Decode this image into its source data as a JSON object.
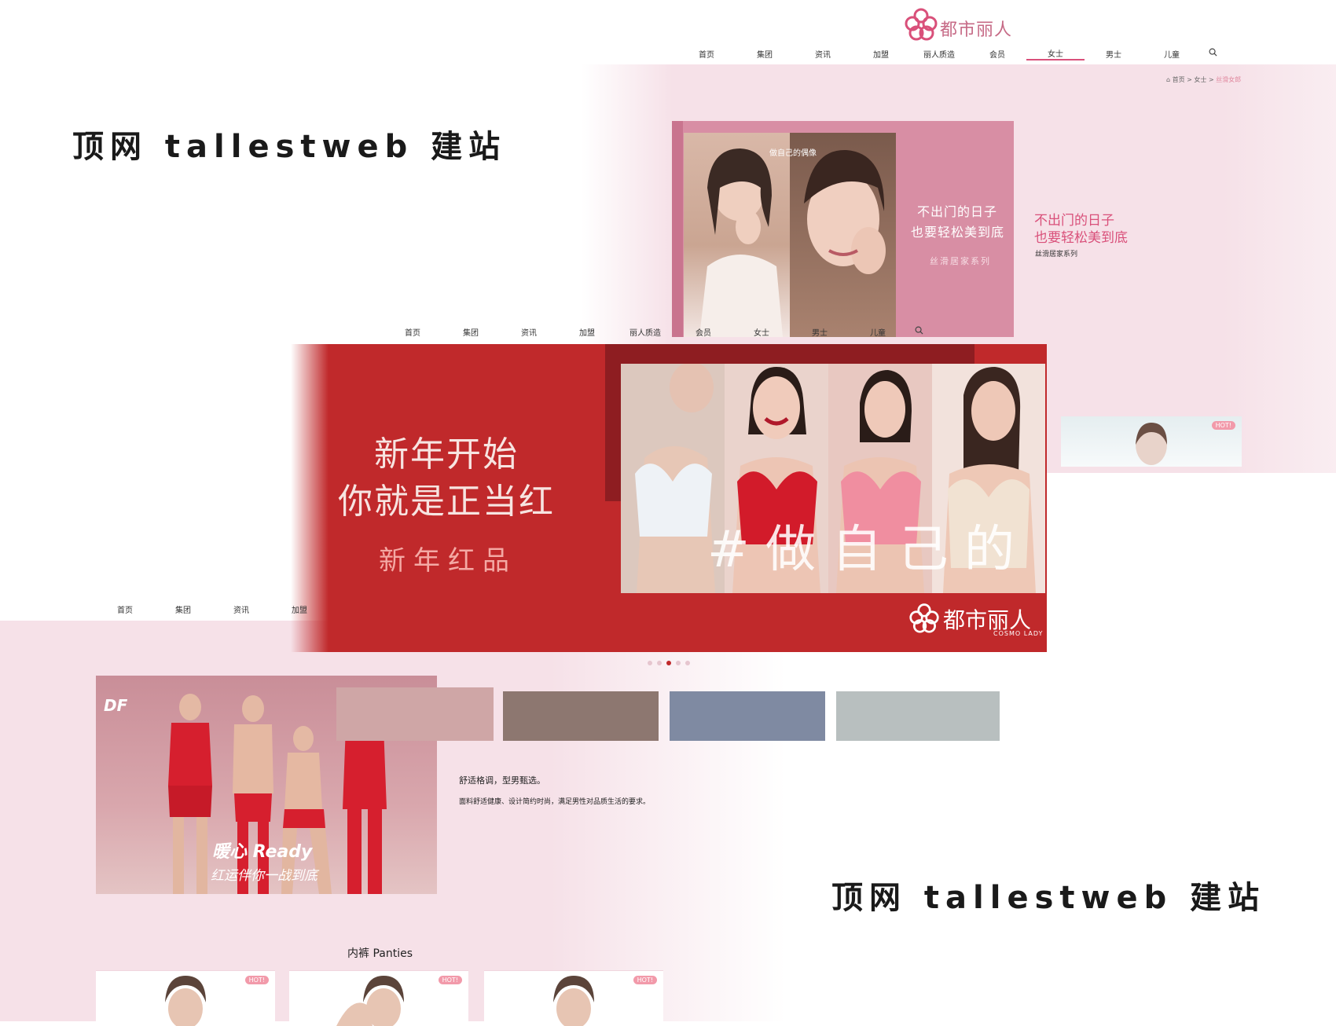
{
  "watermark": {
    "top": "顶网 tallestweb 建站",
    "bottom": "顶网 tallestweb 建站"
  },
  "site": {
    "logo_text": "都市丽人",
    "logo_sub": "COSMO LADY",
    "nav": [
      "首页",
      "集团",
      "资讯",
      "加盟",
      "丽人质造",
      "会员",
      "女士",
      "男士",
      "儿童"
    ],
    "nav_partial": [
      "首页",
      "集团",
      "资讯",
      "加盟"
    ]
  },
  "breadcrumb": {
    "home": "首页",
    "sep1": ">",
    "section": "女士",
    "sep2": ">",
    "current": "丝滑女郎"
  },
  "women_banner": {
    "tag": "做自己的偶像",
    "headline_line1": "不出门的日子",
    "headline_line2": "也要轻松美到底",
    "series": "丝滑居家系列",
    "side_line1": "不出门的日子",
    "side_line2": "也要轻松美到底",
    "side_series": "丝滑居家系列"
  },
  "hero": {
    "line1": "新年开始",
    "line2": "你就是正当红",
    "line3": "新年红品",
    "overlay": "# 做 自 己 的"
  },
  "carousel": {
    "dots": 5,
    "active_index": 2
  },
  "men_banner": {
    "brand": "DF",
    "slogan_line1": "暖心 Ready",
    "slogan_line2": "红运伴你一战到底",
    "heading": "舒适格调，型男甄选。",
    "desc": "面料舒适健康、设计简约时尚，满足男性对品质生活的要求。"
  },
  "panties": {
    "title": "内裤 Panties",
    "hot_label": "HOT!"
  },
  "colors": {
    "brand_pink": "#d9507a",
    "hero_red": "#c0292b",
    "soft_pink": "#f6e1e8"
  },
  "icons": [
    "search-icon",
    "home-icon",
    "flower-logo-icon"
  ]
}
